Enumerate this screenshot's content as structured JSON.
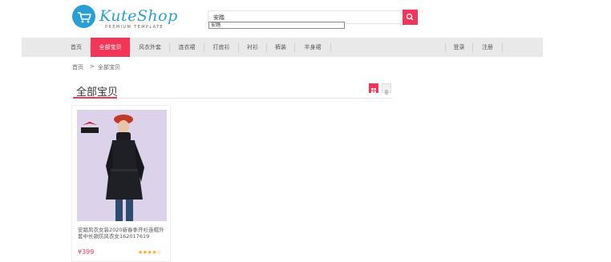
{
  "header": {
    "logo_text": "KuteShop",
    "logo_subtitle": "PREMIUM TEMPLATE",
    "search_value": "安踏",
    "search_suggestion": "安踏"
  },
  "nav": {
    "items": [
      "首页",
      "全部宝贝",
      "风衣外套",
      "连衣裙",
      "打底衫",
      "衬衫",
      "裤装",
      "半身裙"
    ],
    "active_index": 1,
    "login": "登录",
    "register": "注册"
  },
  "breadcrumb": {
    "home": "首页",
    "separator": ">",
    "current": "全部宝贝"
  },
  "section": {
    "title": "全部宝贝"
  },
  "products": [
    {
      "title": "安踏风衣女装2020新春季开衫连帽外套中长款防风衣女162017619",
      "price": "¥399",
      "rating_stars": "★★★★☆",
      "brand_mark": "ANTA"
    }
  ],
  "colors": {
    "accent": "#f2365a",
    "logo": "#2a9fd6",
    "nav_bg": "#e9e9e9",
    "star": "#f5a623"
  }
}
